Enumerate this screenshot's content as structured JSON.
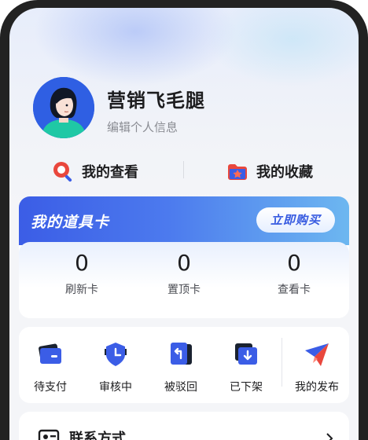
{
  "profile": {
    "name": "营销飞毛腿",
    "edit_label": "编辑个人信息"
  },
  "quick_links": {
    "views_label": "我的查看",
    "favorites_label": "我的收藏"
  },
  "props_card": {
    "title": "我的道具卡",
    "buy_label": "立即购买",
    "stats": [
      {
        "value": "0",
        "label": "刷新卡"
      },
      {
        "value": "0",
        "label": "置顶卡"
      },
      {
        "value": "0",
        "label": "查看卡"
      }
    ]
  },
  "orders": [
    {
      "label": "待支付",
      "icon": "wallet-icon"
    },
    {
      "label": "审核中",
      "icon": "shield-clock-icon"
    },
    {
      "label": "被驳回",
      "icon": "return-icon"
    },
    {
      "label": "已下架",
      "icon": "download-folder-icon"
    },
    {
      "label": "我的发布",
      "icon": "send-icon"
    }
  ],
  "contact": {
    "title": "联系方式"
  },
  "colors": {
    "accent_blue": "#3b5de6",
    "accent_red": "#e9473d",
    "text_primary": "#1d1d1f",
    "text_secondary": "#8a8c93"
  }
}
